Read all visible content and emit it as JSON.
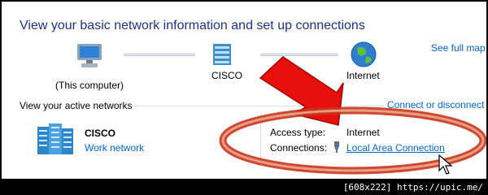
{
  "header": {
    "title": "View your basic network information and set up connections",
    "see_full_map": "See full map"
  },
  "network_map": {
    "this_computer_label": "(This computer)",
    "router_label": "CISCO",
    "internet_label": "Internet"
  },
  "active_networks": {
    "heading": "View your active networks",
    "connect_disconnect": "Connect or disconnect",
    "network_name": "CISCO",
    "network_type": "Work network",
    "access_type_label": "Access type:",
    "access_type_value": "Internet",
    "connections_label": "Connections:",
    "connection_name": "Local Area Connection"
  },
  "annotation": {
    "arrow_color": "#e8100c",
    "ellipse_color": "#c8361c"
  },
  "footer": {
    "text": "[608x222] https://upic.me/"
  }
}
